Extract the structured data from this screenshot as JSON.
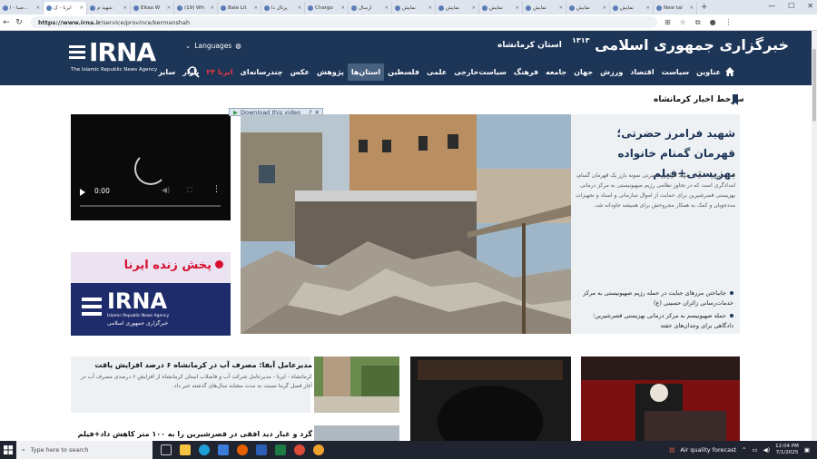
{
  "browser": {
    "tabs": [
      {
        "label": "صبا - ا..."
      },
      {
        "label": "ایرنا - ک",
        "active": true
      },
      {
        "label": "شهید م"
      },
      {
        "label": "Eitaa W"
      },
      {
        "label": "(19) Wh"
      },
      {
        "label": "Bale Lit"
      },
      {
        "label": "پرتال دا"
      },
      {
        "label": "Chargo"
      },
      {
        "label": "ارسال"
      },
      {
        "label": "نمایش"
      },
      {
        "label": "نمایش"
      },
      {
        "label": "نمایش"
      },
      {
        "label": "نمایش"
      },
      {
        "label": "نمایش"
      },
      {
        "label": "نمایش"
      },
      {
        "label": "New tal"
      }
    ],
    "url_host": "https://www.irna.ir",
    "url_path": "/service/province/kermanshah"
  },
  "header": {
    "logo_text": "IRNA",
    "logo_sub": "The Islamic Republic News Agency",
    "languages_label": "Languages",
    "province_label": "استان کرمانشاه",
    "agency_name": "خبرگزاری جمهوری اسلامی",
    "agency_year": "۱۳۱۳",
    "menu": [
      {
        "label": "عناوین"
      },
      {
        "label": "سیاست"
      },
      {
        "label": "اقتصاد"
      },
      {
        "label": "ورزش"
      },
      {
        "label": "جهان"
      },
      {
        "label": "جامعه"
      },
      {
        "label": "فرهنگ"
      },
      {
        "label": "سیاست‌خارجی"
      },
      {
        "label": "علمی"
      },
      {
        "label": "فلسطین"
      },
      {
        "label": "استان‌ها",
        "highlight": true
      },
      {
        "label": "پژوهش"
      },
      {
        "label": "عکس"
      },
      {
        "label": "چندرسانه‌ای"
      },
      {
        "label": "ایرنا ۲۴",
        "red": true
      },
      {
        "label": "بازار"
      },
      {
        "label": "سایر"
      }
    ]
  },
  "section_title": "سرخط اخبار کرمانشاه",
  "video": {
    "time": "0:00",
    "download_label": "Download this video",
    "download_help": "?"
  },
  "live": {
    "banner_text": "پخش زنده ایرنا",
    "logo_text": "IRNA",
    "logo_sub": "Islamic Republic News Agency",
    "logo_fa": "خبرگزاری جمهوری اسلامی"
  },
  "hero": {
    "title": "شهید فرامرز حضرتی؛ قهرمان گمنام خانواده بهزیستی+فیلم",
    "lead": "قصرشیرین - ایرنا - شهید فرامرز حضرتی نمونه بارز یک قهرمان گمنام، امدادگری است که در تجاوز نظامی رژیم صهیونیستی به مرکز درمانی بهزیستی قصرشیرین برای حمایت از اموال سازمانی و اسناد و تجهیزات مددجویان و کمک به همکار مجروحش برای همیشه جاودانه شد.",
    "related": [
      "جانباختن مرزهای جنایت در حمله رژیم صهیونیستی به مرکز خدمات‌رسانی زائران حسینی (ع)",
      "حمله صهیونیسم به مرکز درمانی بهزیستی قصرشیرین؛ دادگاهی برای وجدان‌های خفته"
    ]
  },
  "cards": [
    {
      "title": "مدیرعامل آبفا: مصرف آب در کرمانشاه ۶ درصد افزایش یافت",
      "lead": "کرمانشاه - ایرنا - مدیرعامل شرکت آب و فاضلاب استان کرمانشاه از افزایش ۶ درصدی مصرف آب در آغاز فصل گرما نسبت به مدت مشابه سال‌های گذشته خبر داد."
    },
    {
      "title": "گرد و غبار دید افقی در قصرشیرین را به ۱۰۰ متر کاهش داد+فیلم"
    }
  ],
  "taskbar": {
    "search_placeholder": "Type here to search",
    "weather": "Air quality forecast",
    "time": "12:04 PM",
    "date": "7/1/2025"
  }
}
